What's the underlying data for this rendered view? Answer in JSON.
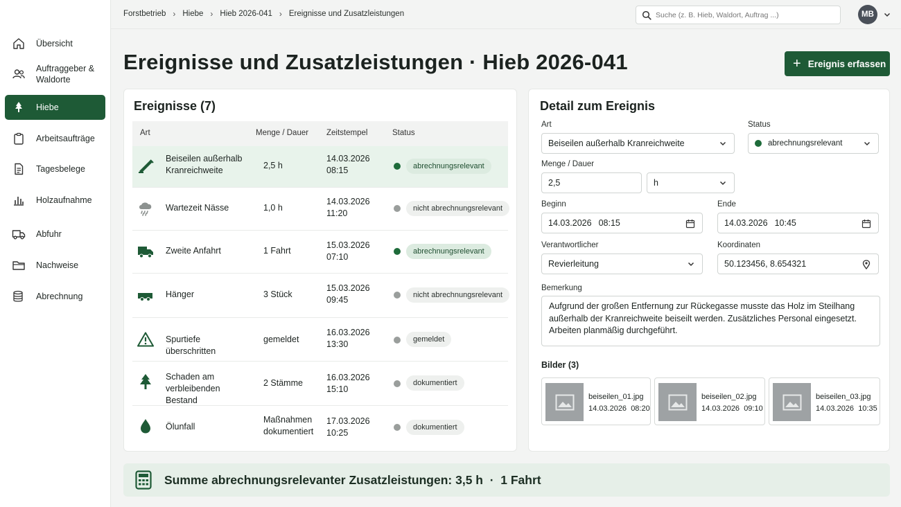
{
  "breadcrumb": [
    "Forstbetrieb",
    "Hiebe",
    "Hieb 2026-041",
    "Ereignisse und Zusatzleistungen"
  ],
  "search": {
    "placeholder": "Suche (z. B. Hieb, Waldort, Auftrag ...)"
  },
  "user": {
    "initials": "MB"
  },
  "sidebar": {
    "items": [
      {
        "label": "Übersicht",
        "icon": "home-icon"
      },
      {
        "label": "Auftraggeber & Waldorte",
        "icon": "users-icon"
      },
      {
        "label": "Hiebe",
        "icon": "tree-icon",
        "active": true
      },
      {
        "label": "Arbeitsaufträge",
        "icon": "clipboard-icon"
      },
      {
        "label": "Tagesbelege",
        "icon": "document-icon"
      },
      {
        "label": "Holzaufnahme",
        "icon": "bar-chart-icon"
      },
      {
        "label": "Abfuhr",
        "icon": "truck-icon"
      },
      {
        "label": "Nachweise",
        "icon": "folder-icon"
      },
      {
        "label": "Abrechnung",
        "icon": "coins-icon"
      }
    ]
  },
  "page": {
    "title": "Ereignisse und Zusatzleistungen · Hieb 2026-041",
    "add_button": "Ereignis erfassen"
  },
  "events": {
    "title": "Ereignisse (7)",
    "columns": [
      "Art",
      "Menge / Dauer",
      "Zeitstempel",
      "Status"
    ],
    "rows": [
      {
        "art": "Beiseilen außerhalb Kranreichweite",
        "menge": "2,5 h",
        "datum": "14.03.2026",
        "zeit": "08:15",
        "status": "abrechnungsrelevant",
        "icon": "crane-icon",
        "relevant": true
      },
      {
        "art": "Wartezeit Nässe",
        "menge": "1,0 h",
        "datum": "14.03.2026",
        "zeit": "11:20",
        "status": "nicht abrechnungsrelevant",
        "icon": "rain-cloud-icon",
        "relevant": false
      },
      {
        "art": "Zweite Anfahrt",
        "menge": "1 Fahrt",
        "datum": "15.03.2026",
        "zeit": "07:10",
        "status": "abrechnungsrelevant",
        "icon": "truck-icon",
        "relevant": true
      },
      {
        "art": "Hänger",
        "menge": "3 Stück",
        "datum": "15.03.2026",
        "zeit": "09:45",
        "status": "nicht abrechnungsrelevant",
        "icon": "trailer-icon",
        "relevant": false
      },
      {
        "art": "Spurtiefe überschritten",
        "menge": "gemeldet",
        "datum": "16.03.2026",
        "zeit": "13:30",
        "status": "gemeldet",
        "icon": "warning-icon",
        "relevant": false
      },
      {
        "art": "Schaden am verbleibenden Bestand",
        "menge": "2 Stämme",
        "datum": "16.03.2026",
        "zeit": "15:10",
        "status": "dokumentiert",
        "icon": "tree-icon",
        "relevant": false
      },
      {
        "art": "Ölunfall",
        "menge": "Maßnahmen dokumentiert",
        "datum": "17.03.2026",
        "zeit": "10:25",
        "status": "dokumentiert",
        "icon": "oil-drop-icon",
        "relevant": false
      }
    ]
  },
  "detail": {
    "title": "Detail zum Ereignis",
    "art_label": "Art",
    "art_value": "Beiseilen außerhalb Kranreichweite",
    "status_label": "Status",
    "status_value": "abrechnungsrelevant",
    "menge_label": "Menge / Dauer",
    "menge_value": "2,5",
    "unit_value": "h",
    "beginn_label": "Beginn",
    "beginn_date": "14.03.2026",
    "beginn_time": "08:15",
    "ende_label": "Ende",
    "ende_date": "14.03.2026",
    "ende_time": "10:45",
    "verantwortlicher_label": "Verantwortlicher",
    "verantwortlicher_value": "Revierleitung",
    "koordinaten_label": "Koordinaten",
    "koordinaten_value": "50.123456, 8.654321",
    "bemerkung_label": "Bemerkung",
    "bemerkung_value": "Aufgrund der großen Entfernung zur Rückegasse musste das Holz im Steilhang außerhalb der Kranreichweite beiseilt werden. Zusätzliches Personal eingesetzt. Arbeiten planmäßig durchgeführt.",
    "bilder_label": "Bilder (3)",
    "images": [
      {
        "name": "beiseilen_01.jpg",
        "date": "14.03.2026",
        "time": "08:20"
      },
      {
        "name": "beiseilen_02.jpg",
        "date": "14.03.2026",
        "time": "09:10"
      },
      {
        "name": "beiseilen_03.jpg",
        "date": "14.03.2026",
        "time": "10:35"
      }
    ]
  },
  "summary": {
    "text": "Summe abrechnungsrelevanter Zusatzleistungen: 3,5 h  ·  1 Fahrt"
  },
  "colors": {
    "brand": "#1e5a36",
    "selected_row": "#e8f3eb",
    "relevant_dot": "#1e6b3a",
    "neutral_dot": "#9a9e9c"
  }
}
